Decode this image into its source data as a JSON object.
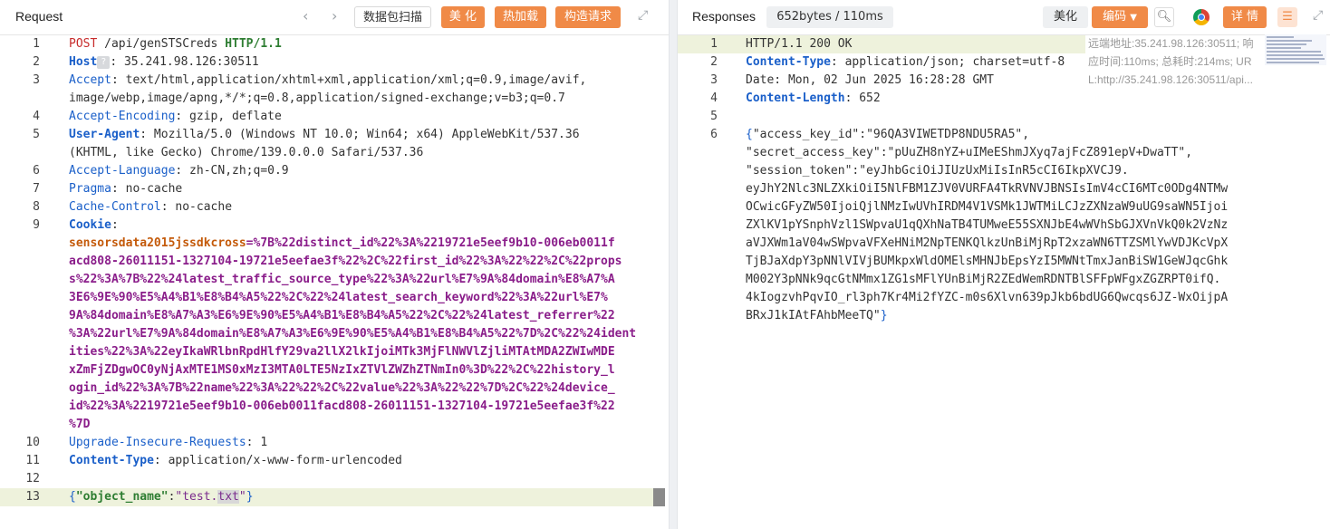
{
  "request": {
    "title": "Request",
    "buttons": {
      "scan": "数据包扫描",
      "beautify": "美 化",
      "hotload": "热加载",
      "construct": "构造请求"
    },
    "lines": [
      {
        "n": "1",
        "segs": [
          [
            "POST",
            "m"
          ],
          [
            " /api/genSTSCreds ",
            ""
          ],
          [
            "HTTP/1.1",
            "g"
          ]
        ]
      },
      {
        "n": "2",
        "segs": [
          [
            "Host",
            "k"
          ],
          [
            "BADGE",
            ""
          ],
          [
            ": 35.241.98.126:30511",
            ""
          ]
        ]
      },
      {
        "n": "3",
        "segs": [
          [
            "Accept",
            "kn"
          ],
          [
            ": text/html,application/xhtml+xml,application/xml;q=0.9,image/avif,",
            ""
          ]
        ]
      },
      {
        "n": "",
        "segs": [
          [
            "image/webp,image/apng,*/*;q=0.8,application/signed-exchange;v=b3;q=0.7",
            ""
          ]
        ]
      },
      {
        "n": "4",
        "segs": [
          [
            "Accept-Encoding",
            "kn"
          ],
          [
            ": gzip, deflate",
            ""
          ]
        ]
      },
      {
        "n": "5",
        "segs": [
          [
            "User-Agent",
            "k"
          ],
          [
            ": Mozilla/5.0 (Windows NT 10.0; Win64; x64) AppleWebKit/537.36",
            ""
          ]
        ]
      },
      {
        "n": "",
        "segs": [
          [
            "(KHTML, like Gecko) Chrome/139.0.0.0 Safari/537.36",
            ""
          ]
        ]
      },
      {
        "n": "6",
        "segs": [
          [
            "Accept-Language",
            "kn"
          ],
          [
            ": zh-CN,zh;q=0.9",
            ""
          ]
        ]
      },
      {
        "n": "7",
        "segs": [
          [
            "Pragma",
            "kn"
          ],
          [
            ": no-cache",
            ""
          ]
        ]
      },
      {
        "n": "8",
        "segs": [
          [
            "Cache-Control",
            "kn"
          ],
          [
            ": no-cache",
            ""
          ]
        ]
      },
      {
        "n": "9",
        "segs": [
          [
            "Cookie",
            "k"
          ],
          [
            ": ",
            ""
          ]
        ]
      },
      {
        "n": "",
        "segs": [
          [
            "sensorsdata2015jssdkcross",
            "ck"
          ],
          [
            "=%7B%22distinct_id%22%3A%2219721e5eef9b10-006eb0011f",
            "cv"
          ]
        ]
      },
      {
        "n": "",
        "segs": [
          [
            "acd808-26011151-1327104-19721e5eefae3f%22%2C%22first_id%22%3A%22%22%2C%22props",
            "cv"
          ]
        ]
      },
      {
        "n": "",
        "segs": [
          [
            "s%22%3A%7B%22%24latest_traffic_source_type%22%3A%22url%E7%9A%84domain%E8%A7%A",
            "cv"
          ]
        ]
      },
      {
        "n": "",
        "segs": [
          [
            "3E6%9E%90%E5%A4%B1%E8%B4%A5%22%2C%22%24latest_search_keyword%22%3A%22url%E7%",
            "cv"
          ]
        ]
      },
      {
        "n": "",
        "segs": [
          [
            "9A%84domain%E8%A7%A3%E6%9E%90%E5%A4%B1%E8%B4%A5%22%2C%22%24latest_referrer%22",
            "cv"
          ]
        ]
      },
      {
        "n": "",
        "segs": [
          [
            "%3A%22url%E7%9A%84domain%E8%A7%A3%E6%9E%90%E5%A4%B1%E8%B4%A5%22%7D%2C%22%24ident",
            "cv"
          ]
        ]
      },
      {
        "n": "",
        "segs": [
          [
            "ities%22%3A%22eyIkaWRlbnRpdHlfY29va2llX2lkIjoiMTk3MjFlNWVlZjliMTAtMDA2ZWIwMDE",
            "cv"
          ]
        ]
      },
      {
        "n": "",
        "segs": [
          [
            "xZmFjZDgwOC0yNjAxMTE1MS0xMzI3MTA0LTE5NzIxZTVlZWZhZTNmIn0%3D%22%2C%22history_l",
            "cv"
          ]
        ]
      },
      {
        "n": "",
        "segs": [
          [
            "ogin_id%22%3A%7B%22name%22%3A%22%22%2C%22value%22%3A%22%22%7D%2C%22%24device_",
            "cv"
          ]
        ]
      },
      {
        "n": "",
        "segs": [
          [
            "id%22%3A%2219721e5eef9b10-006eb0011facd808-26011151-1327104-19721e5eefae3f%22",
            "cv"
          ]
        ]
      },
      {
        "n": "",
        "segs": [
          [
            "%7D",
            "cv"
          ]
        ]
      },
      {
        "n": "10",
        "segs": [
          [
            "Upgrade-Insecure-Requests",
            "kn"
          ],
          [
            ": 1",
            ""
          ]
        ]
      },
      {
        "n": "11",
        "segs": [
          [
            "Content-Type",
            "k"
          ],
          [
            ": application/x-www-form-urlencoded",
            ""
          ]
        ]
      },
      {
        "n": "12",
        "segs": []
      },
      {
        "n": "13",
        "segs": [
          [
            "{",
            "js"
          ],
          [
            "\"object_name\"",
            "g"
          ],
          [
            ":",
            ""
          ],
          [
            "\"test.",
            "jv"
          ],
          [
            "txt",
            "jv sel"
          ],
          [
            "\"",
            "jv"
          ],
          [
            "}",
            "js"
          ]
        ],
        "hl": true
      }
    ]
  },
  "response": {
    "title": "Responses",
    "size_label": "652bytes / 110ms",
    "buttons": {
      "beautify": "美化",
      "encoding": "编码",
      "detail": "详 情"
    },
    "meta": [
      "远端地址:35.241.98.126:30511; 响",
      "应时间:110ms; 总耗时:214ms; UR",
      "L:http://35.241.98.126:30511/api..."
    ],
    "lines": [
      {
        "n": "1",
        "segs": [
          [
            "HTTP/1.1 200 OK",
            ""
          ]
        ],
        "hl": true
      },
      {
        "n": "2",
        "segs": [
          [
            "Content-Type",
            "k"
          ],
          [
            ": application/json; charset=utf-8",
            ""
          ]
        ]
      },
      {
        "n": "3",
        "segs": [
          [
            "Date: Mon, 02 Jun 2025 16:28:28 GMT",
            ""
          ]
        ]
      },
      {
        "n": "4",
        "segs": [
          [
            "Content-Length",
            "k"
          ],
          [
            ": 652",
            ""
          ]
        ]
      },
      {
        "n": "5",
        "segs": []
      },
      {
        "n": "6",
        "segs": [
          [
            "{",
            "jb"
          ],
          [
            "\"access_key_id\"",
            ""
          ],
          [
            ":",
            ""
          ],
          [
            "\"96QA3VIWETDP8NDU5RA5\"",
            ""
          ],
          [
            ",",
            ""
          ]
        ]
      },
      {
        "n": "",
        "segs": [
          [
            "\"secret_access_key\":\"pUuZH8nYZ+uIMeEShmJXyq7ajFcZ891epV+DwaTT\",",
            ""
          ]
        ]
      },
      {
        "n": "",
        "segs": [
          [
            "\"session_token\":\"eyJhbGciOiJIUzUxMiIsInR5cCI6IkpXVCJ9.",
            ""
          ]
        ]
      },
      {
        "n": "",
        "segs": [
          [
            "eyJhY2Nlc3NLZXkiOiI5NlFBM1ZJV0VURFA4TkRVNVJBNSIsImV4cCI6MTc0ODg4NTMw",
            ""
          ]
        ]
      },
      {
        "n": "",
        "segs": [
          [
            "OCwicGFyZW50IjoiQjlNMzIwUVhIRDM4V1VSMk1JWTMiLCJzZXNzaW9uUG9saWN5Ijoi",
            ""
          ]
        ]
      },
      {
        "n": "",
        "segs": [
          [
            "ZXlKV1pYSnphVzl1SWpvaU1qQXhNaTB4TUMweE55SXNJbE4wWVhSbGJXVnVkQ0k2VzNz",
            ""
          ]
        ]
      },
      {
        "n": "",
        "segs": [
          [
            "aVJXWm1aV04wSWpvaVFXeHNiM2NpTENKQlkzUnBiMjRpT2xzaWN6TTZSMlYwVDJKcVpX",
            ""
          ]
        ]
      },
      {
        "n": "",
        "segs": [
          [
            "TjBJaXdpY3pNNlVIVjBUMkpxWldOMElsMHNJbEpsYzI5MWNtTmxJanBiSW1GeWJqcGhk",
            ""
          ]
        ]
      },
      {
        "n": "",
        "segs": [
          [
            "M002Y3pNNk9qcGtNMmx1ZG1sMFlYUnBiMjR2ZEdWemRDNTBlSFFpWFgxZGZRPT0ifQ.",
            ""
          ]
        ]
      },
      {
        "n": "",
        "segs": [
          [
            "4kIogzvhPqvIO_rl3ph7Kr4Mi2fYZC-m0s6Xlvn639pJkb6bdUG6Qwcqs6JZ-WxOijpA",
            ""
          ]
        ]
      },
      {
        "n": "",
        "segs": [
          [
            "BRxJ1kIAtFAhbMeeTQ\"",
            ""
          ],
          [
            "}",
            "jb"
          ]
        ]
      }
    ]
  }
}
